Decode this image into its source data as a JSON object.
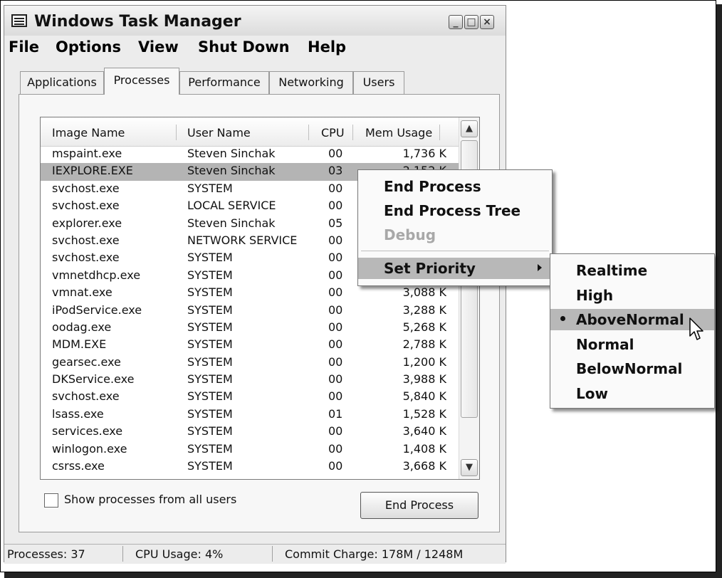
{
  "window": {
    "title": "Windows Task Manager",
    "controls": {
      "minimize": "_",
      "maximize": "□",
      "close": "×"
    }
  },
  "menubar": [
    "File",
    "Options",
    "View",
    "Shut Down",
    "Help"
  ],
  "tabs": [
    "Applications",
    "Processes",
    "Performance",
    "Networking",
    "Users"
  ],
  "active_tab": "Processes",
  "process_list": {
    "columns": [
      "Image Name",
      "User Name",
      "CPU",
      "Mem Usage"
    ],
    "rows": [
      [
        "mspaint.exe",
        "Steven Sinchak",
        "00",
        "1,736 K"
      ],
      [
        "IEXPLORE.EXE",
        "Steven Sinchak",
        "03",
        "2,152 K"
      ],
      [
        "svchost.exe",
        "SYSTEM",
        "00",
        ""
      ],
      [
        "svchost.exe",
        "LOCAL SERVICE",
        "00",
        ""
      ],
      [
        "explorer.exe",
        "Steven Sinchak",
        "05",
        ""
      ],
      [
        "svchost.exe",
        "NETWORK SERVICE",
        "00",
        ""
      ],
      [
        "svchost.exe",
        "SYSTEM",
        "00",
        ""
      ],
      [
        "vmnetdhcp.exe",
        "SYSTEM",
        "00",
        ""
      ],
      [
        "vmnat.exe",
        "SYSTEM",
        "00",
        "3,088 K"
      ],
      [
        "iPodService.exe",
        "SYSTEM",
        "00",
        "3,288 K"
      ],
      [
        "oodag.exe",
        "SYSTEM",
        "00",
        "5,268 K"
      ],
      [
        "MDM.EXE",
        "SYSTEM",
        "00",
        "2,788 K"
      ],
      [
        "gearsec.exe",
        "SYSTEM",
        "00",
        "1,200 K"
      ],
      [
        "DKService.exe",
        "SYSTEM",
        "00",
        "3,988 K"
      ],
      [
        "svchost.exe",
        "SYSTEM",
        "00",
        "5,840 K"
      ],
      [
        "lsass.exe",
        "SYSTEM",
        "01",
        "1,528 K"
      ],
      [
        "services.exe",
        "SYSTEM",
        "00",
        "3,640 K"
      ],
      [
        "winlogon.exe",
        "SYSTEM",
        "00",
        "1,408 K"
      ],
      [
        "csrss.exe",
        "SYSTEM",
        "00",
        "3,668 K"
      ]
    ],
    "selected_row": "IEXPLORE.EXE"
  },
  "show_all_users_label": "Show processes from all users",
  "end_process_button": "End Process",
  "status": {
    "processes": "Processes: 37",
    "cpu": "CPU Usage: 4%",
    "commit": "Commit Charge: 178M / 1248M"
  },
  "context_menu": {
    "end_process": "End Process",
    "end_process_tree": "End Process Tree",
    "debug": "Debug",
    "set_priority": "Set Priority"
  },
  "priority_menu": {
    "items": [
      "Realtime",
      "High",
      "AboveNormal",
      "Normal",
      "BelowNormal",
      "Low"
    ],
    "selected": "AboveNormal"
  }
}
